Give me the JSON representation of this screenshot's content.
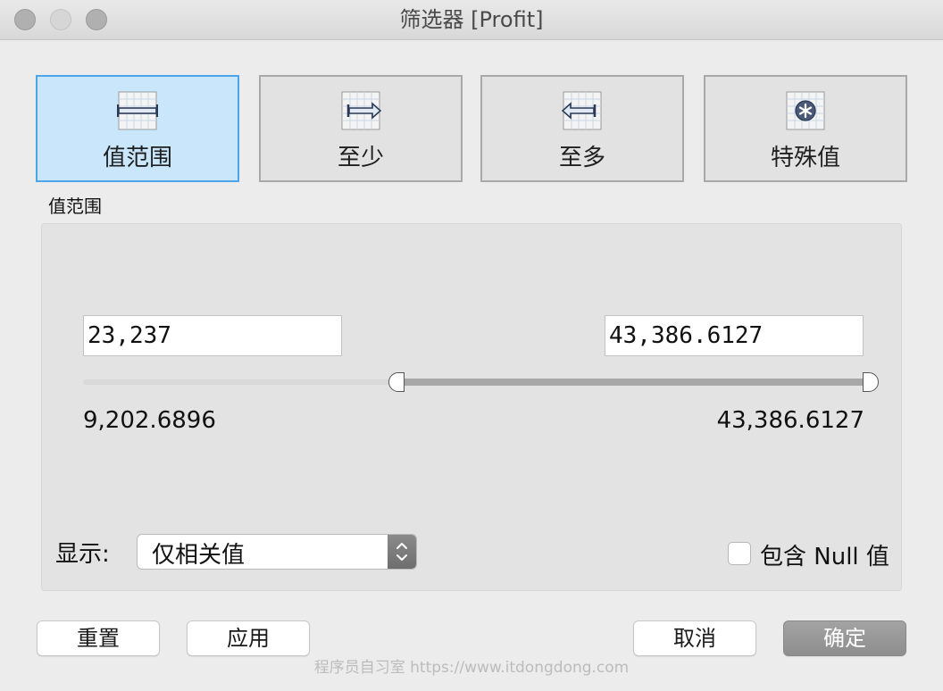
{
  "window": {
    "title": "筛选器 [Profit]"
  },
  "mode_tabs": [
    {
      "label": "值范围",
      "icon": "range-icon",
      "active": true
    },
    {
      "label": "至少",
      "icon": "at-least-icon",
      "active": false
    },
    {
      "label": "至多",
      "icon": "at-most-icon",
      "active": false
    },
    {
      "label": "特殊值",
      "icon": "special-values-icon",
      "active": false
    }
  ],
  "section_label": "值范围",
  "range": {
    "min_value": "23,237",
    "max_value": "43,386.6127",
    "data_min": "9,202.6896",
    "data_max": "43,386.6127"
  },
  "show": {
    "label": "显示:",
    "selected": "仅相关值"
  },
  "include_null": {
    "label": "包含 Null 值",
    "checked": false
  },
  "buttons": {
    "reset": "重置",
    "apply": "应用",
    "cancel": "取消",
    "ok": "确定"
  },
  "watermark": "程序员自习室 https://www.itdongdong.com",
  "colors": {
    "active_tab_bg": "#c9e6fb",
    "active_tab_border": "#4aa5ea",
    "primary_button": "#9a9a9a"
  }
}
